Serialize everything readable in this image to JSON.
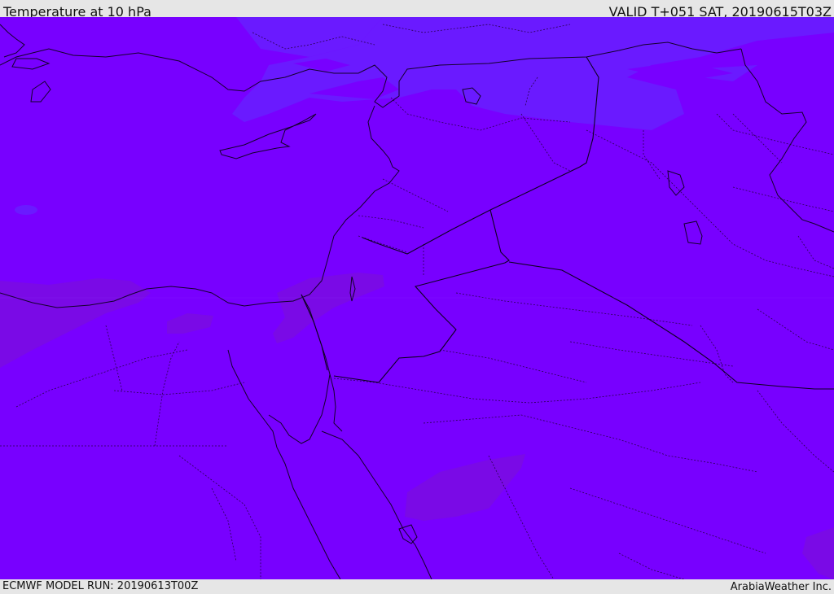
{
  "header": {
    "title": "Temperature at 10 hPa",
    "valid_time": "VALID T+051 SAT, 20190615T03Z"
  },
  "footer": {
    "model_run": "ECMWF MODEL RUN: 20190613T00Z",
    "credit": "ArabiaWeather Inc."
  },
  "map": {
    "base_color": "#7800ff",
    "cool_region_color": "#6a1aff",
    "warm_region_color": "#7a10e0",
    "border_color": "#1a0040"
  }
}
